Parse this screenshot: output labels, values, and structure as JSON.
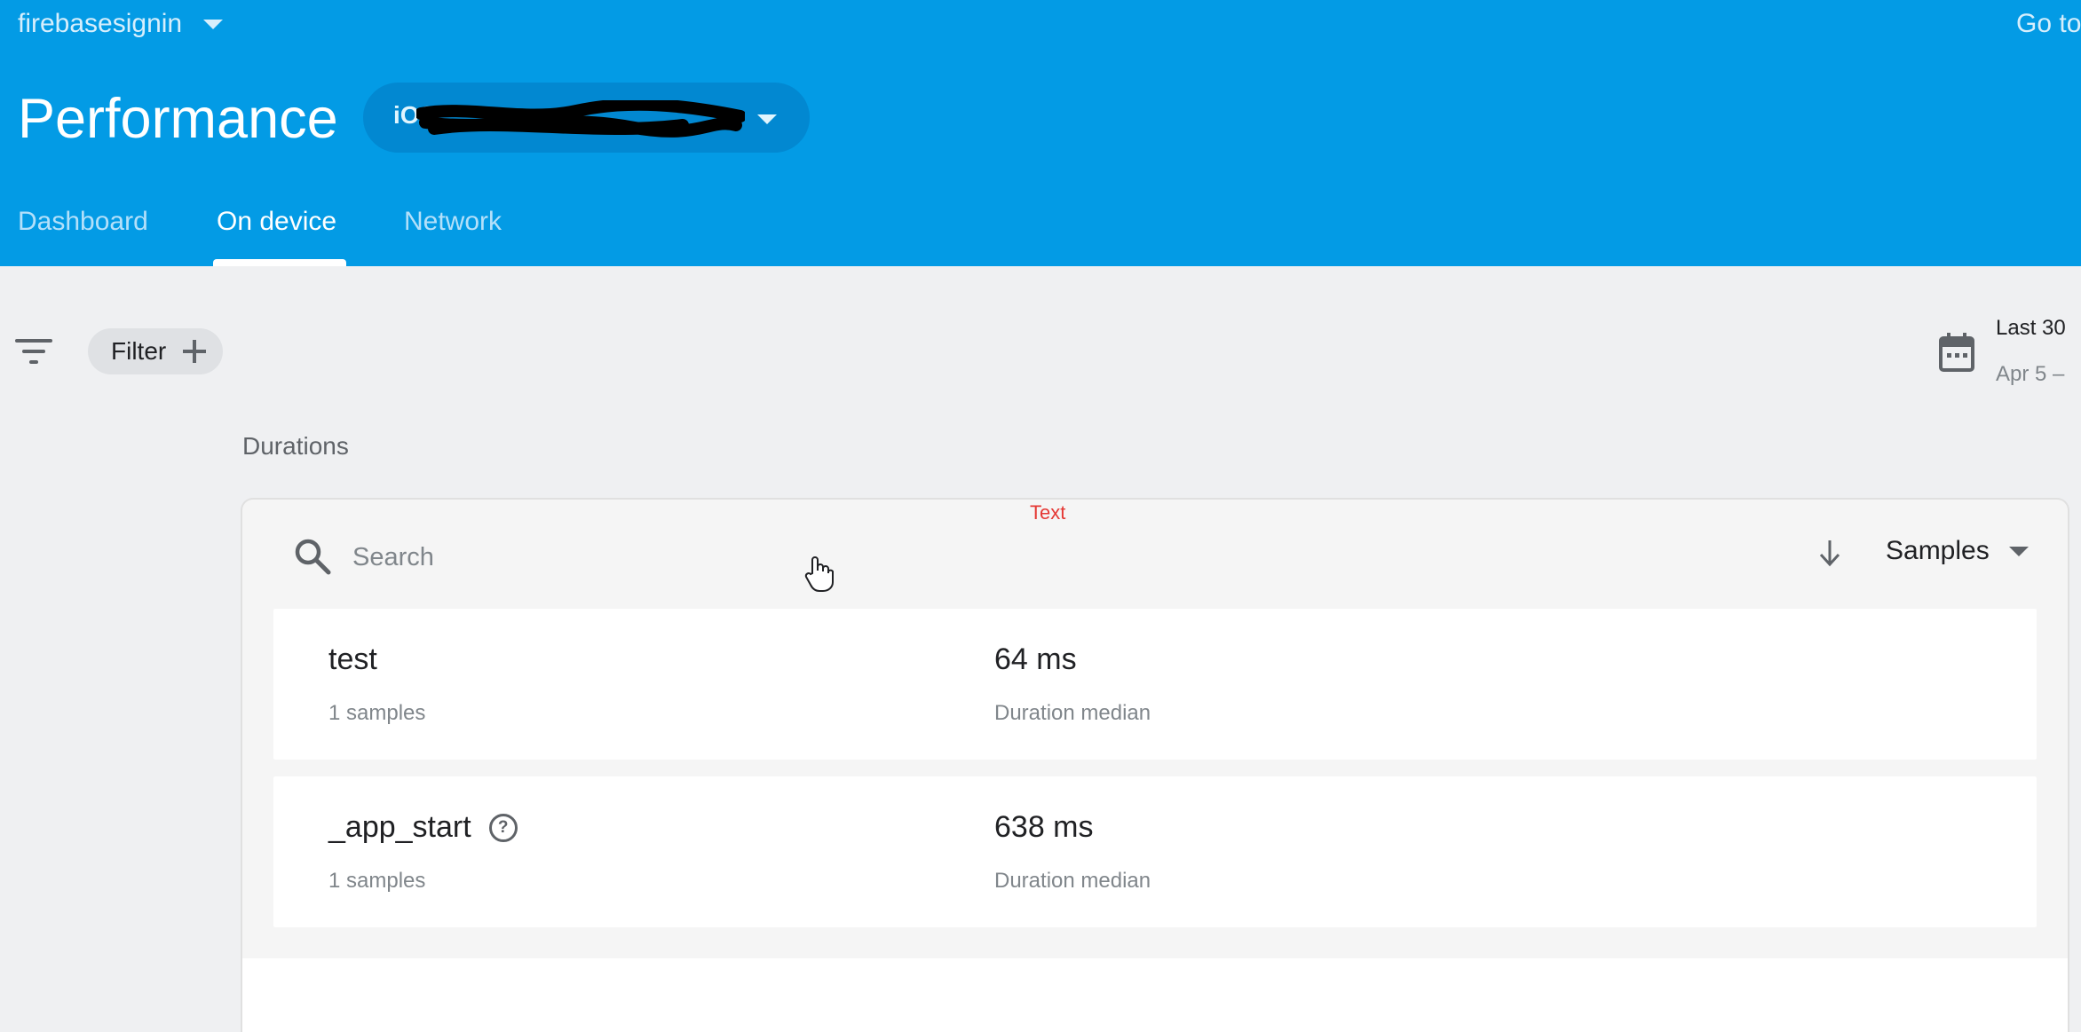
{
  "header": {
    "project_name": "firebasesignin",
    "goto_label": "Go to",
    "page_title": "Performance",
    "app_selector_label": "iOS",
    "tabs": [
      {
        "label": "Dashboard",
        "active": false
      },
      {
        "label": "On device",
        "active": true
      },
      {
        "label": "Network",
        "active": false
      }
    ]
  },
  "toolbar": {
    "filter_label": "Filter",
    "date_range": "Last 30",
    "date_sub": "Apr 5 –"
  },
  "durations": {
    "section_title": "Durations",
    "overlay_text": "Text",
    "search": {
      "placeholder": "Search",
      "value": ""
    },
    "sort_label": "Samples",
    "rows": [
      {
        "name": "test",
        "samples": "1 samples",
        "value": "64 ms",
        "metric": "Duration median",
        "has_help": false
      },
      {
        "name": "_app_start",
        "samples": "1 samples",
        "value": "638 ms",
        "metric": "Duration median",
        "has_help": true
      }
    ]
  },
  "colors": {
    "header_bg": "#039be5",
    "page_bg": "#eff0f2",
    "overlay_text": "#e53935"
  },
  "icons": [
    "chevron-down-icon",
    "filter-list-icon",
    "add-icon",
    "calendar-icon",
    "search-icon",
    "arrow-down-icon",
    "help-icon",
    "hand-cursor-icon"
  ]
}
